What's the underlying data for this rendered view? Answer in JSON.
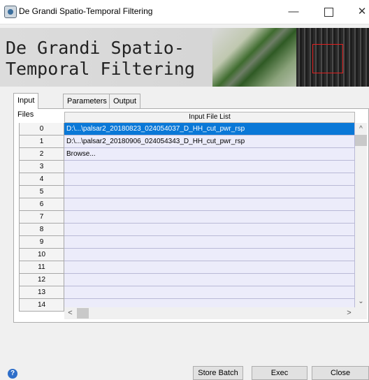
{
  "window": {
    "title": "De Grandi Spatio-Temporal Filtering",
    "minimize_glyph": "—",
    "close_glyph": "✕"
  },
  "banner": {
    "title": "De Grandi Spatio-Temporal Filtering"
  },
  "tabs": [
    {
      "label": "Input Files",
      "active": true
    },
    {
      "label": "Parameters",
      "active": false
    },
    {
      "label": "Output Files",
      "active": false
    }
  ],
  "grid": {
    "header": "Input File List",
    "rows": [
      {
        "num": "0",
        "value": "D:\\...\\palsar2_20180823_024054037_D_HH_cut_pwr_rsp",
        "selected": true
      },
      {
        "num": "1",
        "value": "D:\\...\\palsar2_20180906_024054343_D_HH_cut_pwr_rsp",
        "selected": false
      },
      {
        "num": "2",
        "value": "Browse...",
        "selected": false
      },
      {
        "num": "3",
        "value": "",
        "selected": false
      },
      {
        "num": "4",
        "value": "",
        "selected": false
      },
      {
        "num": "5",
        "value": "",
        "selected": false
      },
      {
        "num": "6",
        "value": "",
        "selected": false
      },
      {
        "num": "7",
        "value": "",
        "selected": false
      },
      {
        "num": "8",
        "value": "",
        "selected": false
      },
      {
        "num": "9",
        "value": "",
        "selected": false
      },
      {
        "num": "10",
        "value": "",
        "selected": false
      },
      {
        "num": "11",
        "value": "",
        "selected": false
      },
      {
        "num": "12",
        "value": "",
        "selected": false
      },
      {
        "num": "13",
        "value": "",
        "selected": false
      },
      {
        "num": "14",
        "value": "",
        "selected": false
      }
    ]
  },
  "scroll": {
    "up": "^",
    "down": "⌄",
    "left": "<",
    "right": ">"
  },
  "footer": {
    "help_glyph": "?",
    "store_batch": "Store Batch",
    "exec": "Exec",
    "close": "Close"
  },
  "colors": {
    "selection": "#0a78d7",
    "row_bg": "#ececfa",
    "accent_red": "#e02020"
  }
}
